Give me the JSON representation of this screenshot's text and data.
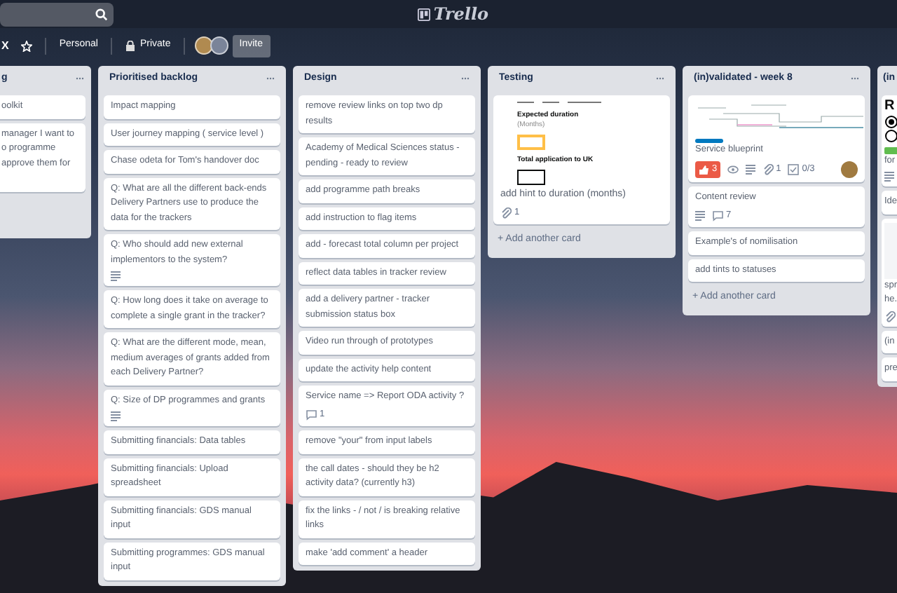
{
  "header": {
    "logo": "Trello"
  },
  "board_bar": {
    "board_name": "X",
    "buttons": [
      {
        "kind": "star"
      },
      {
        "kind": "team",
        "label": "Personal"
      },
      {
        "kind": "visibility",
        "label": "Private"
      }
    ],
    "invite": "Invite"
  },
  "lists": [
    {
      "title": "g",
      "cards": [
        {
          "kind": "text",
          "text": "oolkit"
        },
        {
          "kind": "text",
          "text": "manager I want to\no programme\napprove them for"
        }
      ]
    },
    {
      "title": "Prioritised backlog",
      "cards": [
        {
          "kind": "text",
          "text": "Impact mapping"
        },
        {
          "kind": "text",
          "text": "User journey mapping ( service level )"
        },
        {
          "kind": "text",
          "text": "Chase odeta for Tom's handover doc"
        },
        {
          "kind": "text",
          "text": "Q: What are all the different back-ends Delivery Partners use to produce the data for the trackers"
        },
        {
          "kind": "text",
          "text": "Q: Who should add new external implementors to the system?",
          "badges": [
            {
              "kind": "description"
            }
          ]
        },
        {
          "kind": "text",
          "text": "Q: How long does it take on average to complete a single grant in the tracker?"
        },
        {
          "kind": "text",
          "text": "Q: What are the different mode, mean, medium averages of grants added from each Delivery Partner?"
        },
        {
          "kind": "text",
          "text": "Q: Size of DP programmes and grants",
          "badges": [
            {
              "kind": "description"
            }
          ]
        },
        {
          "kind": "text",
          "text": "Submitting financials: Data tables"
        },
        {
          "kind": "text",
          "text": "Submitting financials: Upload spreadsheet"
        },
        {
          "kind": "text",
          "text": "Submitting financials: GDS manual input"
        },
        {
          "kind": "text",
          "text": "Submitting programmes: GDS manual input"
        }
      ]
    },
    {
      "title": "Design",
      "cards": [
        {
          "kind": "text",
          "text": "remove review links on top two dp results"
        },
        {
          "kind": "text",
          "text": "Academy of Medical Sciences status - pending - ready to review"
        },
        {
          "kind": "text",
          "text": "add programme path breaks"
        },
        {
          "kind": "text",
          "text": "add instruction to flag items"
        },
        {
          "kind": "text",
          "text": "add - forecast total column per project"
        },
        {
          "kind": "text",
          "text": "reflect data tables in tracker review"
        },
        {
          "kind": "text",
          "text": "add a delivery partner - tracker submission status box"
        },
        {
          "kind": "text",
          "text": "Video run through of prototypes"
        },
        {
          "kind": "text",
          "text": "update the activity help content"
        },
        {
          "kind": "text",
          "text": "Service name => Report ODA activity ?",
          "badges": [
            {
              "kind": "comments",
              "count": "1"
            }
          ]
        },
        {
          "kind": "text",
          "text": "remove \"your\" from input labels"
        },
        {
          "kind": "text",
          "text": "the call dates - should they be h2 activity data? (currently h3)"
        },
        {
          "kind": "text",
          "text": "fix the links - / not / is breaking relative links"
        },
        {
          "kind": "text",
          "text": "make 'add comment' a header"
        }
      ]
    },
    {
      "title": "Testing",
      "add_card": "+ Add another card",
      "cards": [
        {
          "kind": "form_preview",
          "fields": [
            {
              "label": "Expected duration",
              "hint": "(Months)",
              "focused": true
            },
            {
              "label": "Total application to UK",
              "focused": false
            }
          ],
          "text": "add hint to duration (months)",
          "badges": [
            {
              "kind": "attachments",
              "count": "1"
            }
          ]
        }
      ]
    },
    {
      "title": "(in)validated - week 8",
      "add_card": "+ Add another card",
      "cards": [
        {
          "kind": "blueprint",
          "color": "#0079bf",
          "text": "Service blueprint",
          "badges": [
            {
              "kind": "votes",
              "count": "3"
            },
            {
              "kind": "watch"
            },
            {
              "kind": "description"
            },
            {
              "kind": "attachments",
              "count": "1"
            },
            {
              "kind": "checklist",
              "count": "0/3"
            }
          ],
          "avatar": true
        },
        {
          "kind": "text",
          "text": "Content review",
          "badges": [
            {
              "kind": "description"
            },
            {
              "kind": "comments",
              "count": "7"
            }
          ]
        },
        {
          "kind": "text",
          "text": "Example's of nomilisation"
        },
        {
          "kind": "text",
          "text": "add tints to statuses"
        }
      ]
    },
    {
      "title": "(in",
      "cards": [
        {
          "kind": "radio_preview",
          "heading": "R",
          "color": "#61bd4f",
          "text": "for",
          "badges": [
            {
              "kind": "description"
            }
          ]
        },
        {
          "kind": "text",
          "text": "Ide"
        },
        {
          "kind": "image",
          "text": "spr\nhe.",
          "badges": [
            {
              "kind": "attachments"
            }
          ]
        },
        {
          "kind": "text",
          "text": "(in"
        },
        {
          "kind": "text",
          "text": "pre"
        }
      ]
    }
  ]
}
